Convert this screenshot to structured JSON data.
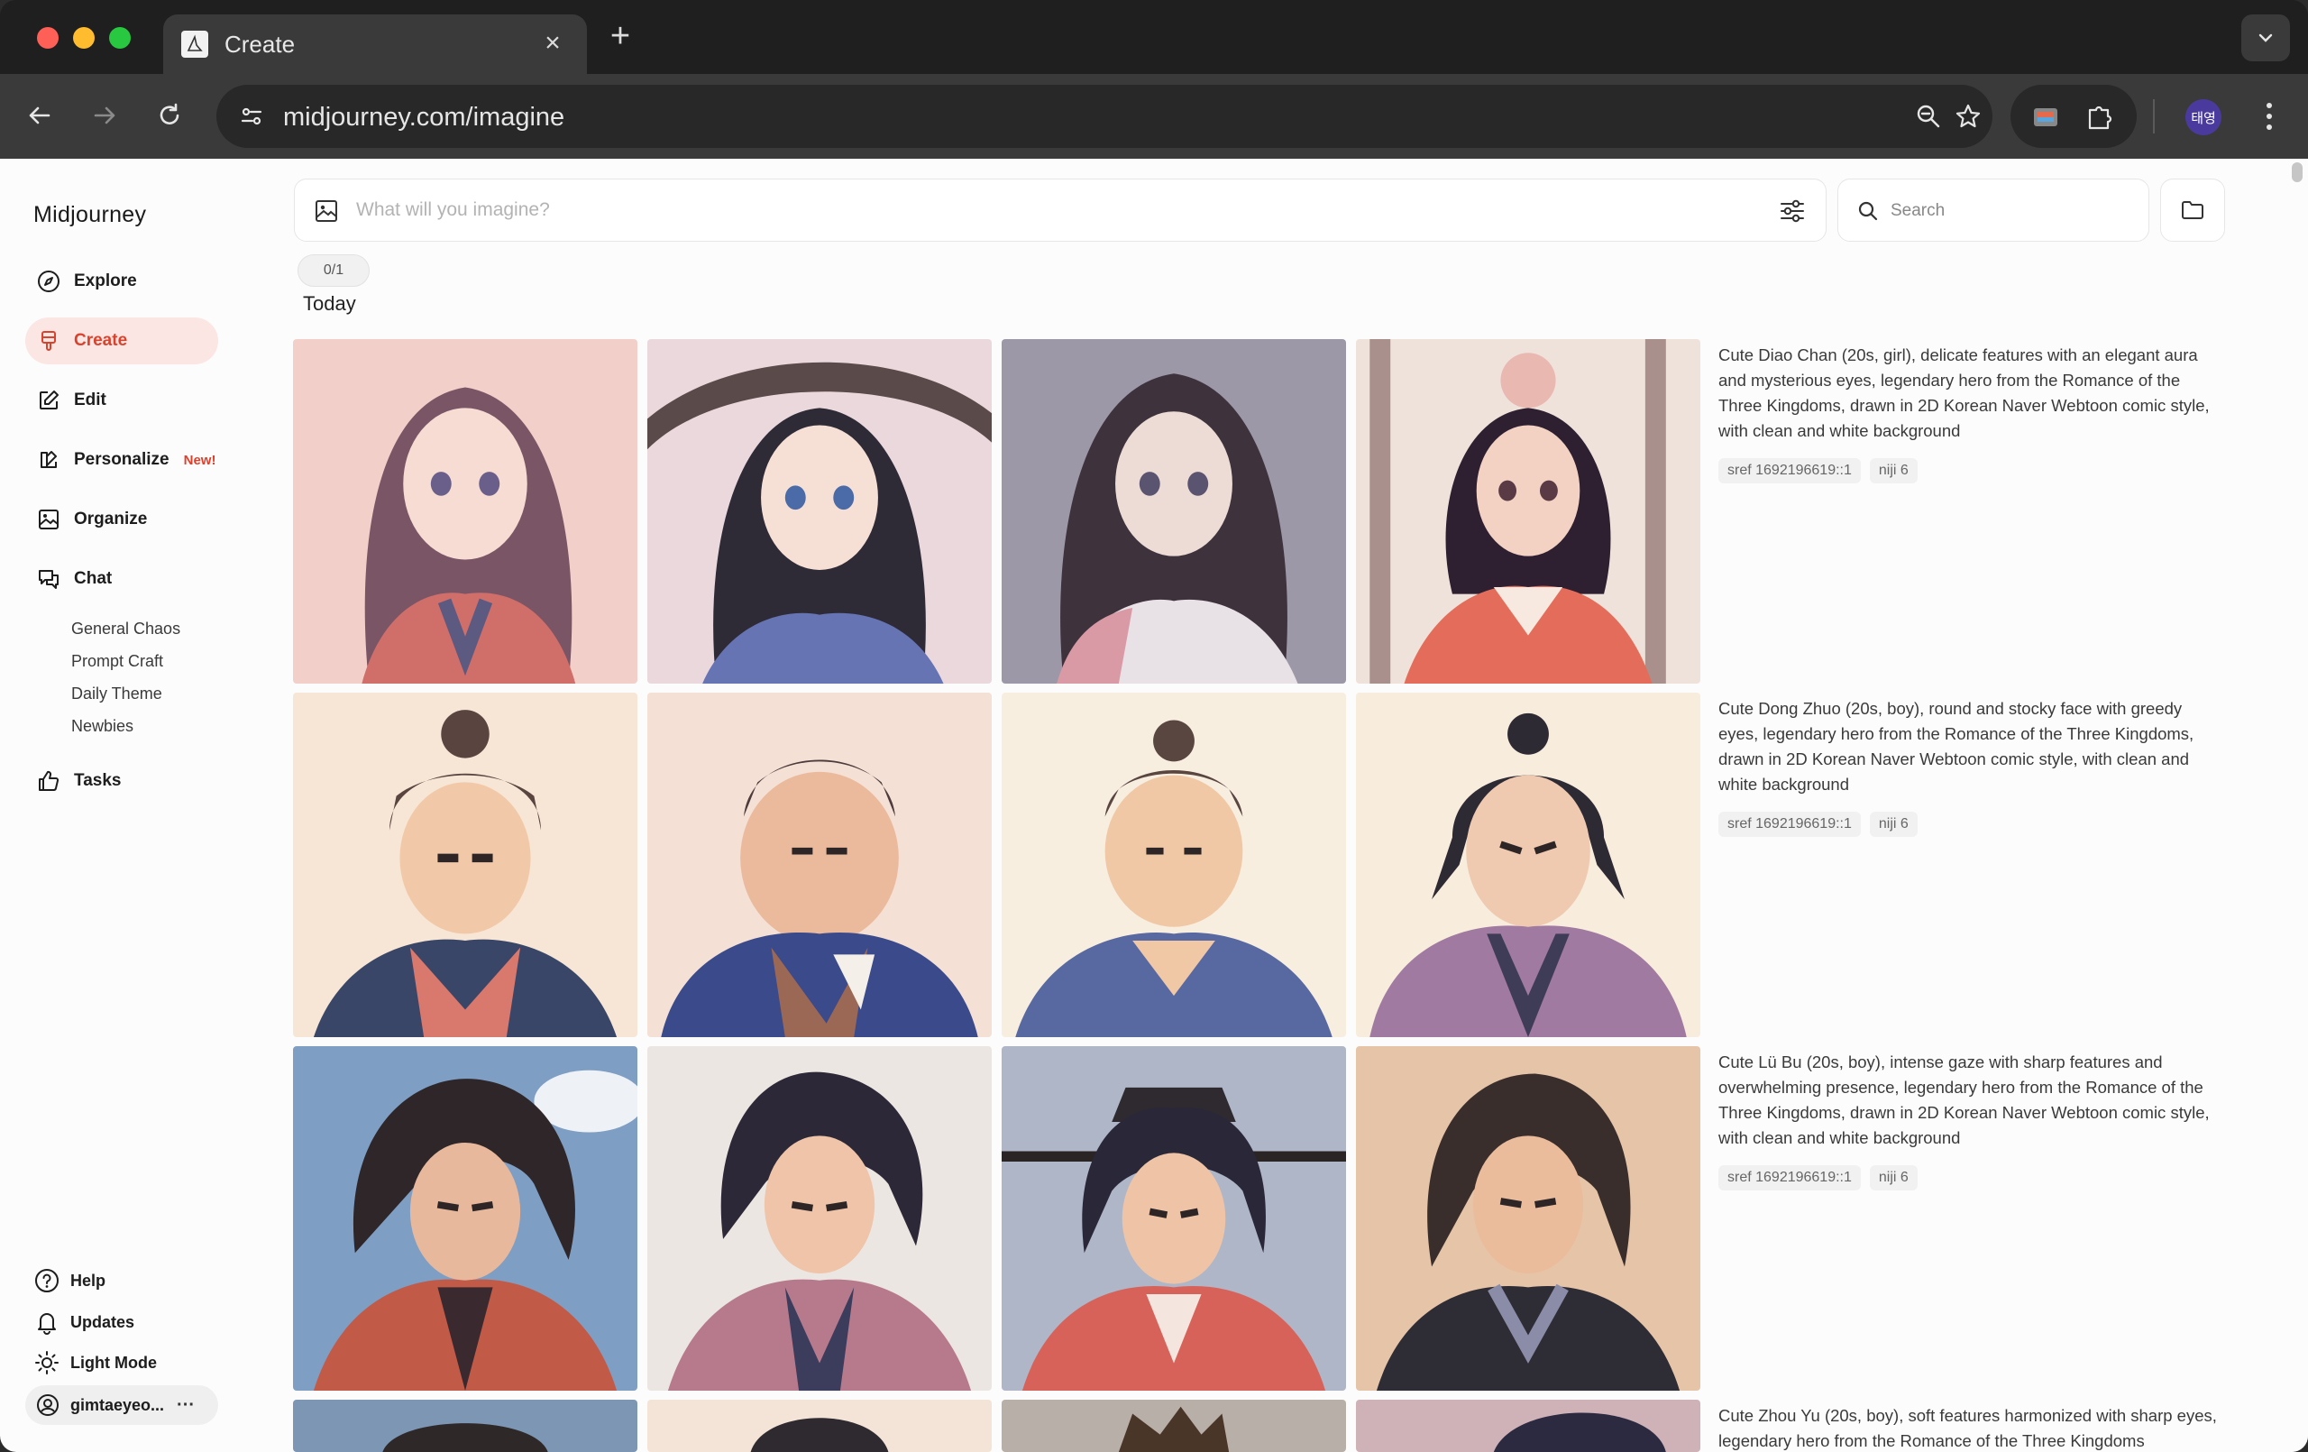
{
  "browser": {
    "tab_title": "Create",
    "tab_close": "×",
    "new_tab": "+",
    "url": "midjourney.com/imagine",
    "profile_initials": "태영"
  },
  "sidebar": {
    "brand": "Midjourney",
    "items": [
      {
        "label": "Explore",
        "icon": "compass-icon"
      },
      {
        "label": "Create",
        "icon": "brush-icon"
      },
      {
        "label": "Edit",
        "icon": "edit-icon"
      },
      {
        "label": "Personalize",
        "icon": "personalize-icon",
        "badge": "New!"
      },
      {
        "label": "Organize",
        "icon": "image-icon"
      },
      {
        "label": "Chat",
        "icon": "chat-icon"
      },
      {
        "label": "Tasks",
        "icon": "thumbs-up-icon"
      }
    ],
    "chat_rooms": [
      "General Chaos",
      "Prompt Craft",
      "Daily Theme",
      "Newbies"
    ],
    "bottom": [
      {
        "label": "Help",
        "icon": "help-icon"
      },
      {
        "label": "Updates",
        "icon": "bell-icon"
      },
      {
        "label": "Light Mode",
        "icon": "sun-icon"
      }
    ],
    "user": {
      "name": "gimtaeyeo...",
      "more": "···"
    }
  },
  "main": {
    "prompt_placeholder": "What will you imagine?",
    "search_placeholder": "Search",
    "counter": "0/1",
    "day": "Today",
    "jobs": [
      {
        "prompt": "Cute Diao Chan (20s, girl), delicate features with an elegant aura and mysterious eyes, legendary hero from the Romance of the Three Kingdoms, drawn in 2D Korean Naver Webtoon comic style, with clean and white background",
        "tags": [
          "sref 1692196619::1",
          "niji 6"
        ]
      },
      {
        "prompt": "Cute Dong Zhuo (20s, boy), round and stocky face with greedy eyes, legendary hero from the Romance of the Three Kingdoms, drawn in 2D Korean Naver Webtoon comic style, with clean and white background",
        "tags": [
          "sref 1692196619::1",
          "niji 6"
        ]
      },
      {
        "prompt": "Cute Lü Bu (20s, boy), intense gaze with sharp features and overwhelming presence, legendary hero from the Romance of the Three Kingdoms, drawn in 2D Korean Naver Webtoon comic style, with clean and white background",
        "tags": [
          "sref 1692196619::1",
          "niji 6"
        ]
      },
      {
        "prompt": "Cute Zhou Yu (20s, boy), soft features harmonized with sharp eyes, legendary hero from the Romance of the Three Kingdoms",
        "tags": []
      }
    ]
  },
  "colors": {
    "accent": "#d8432d",
    "active_bg": "#fbe6e4"
  }
}
